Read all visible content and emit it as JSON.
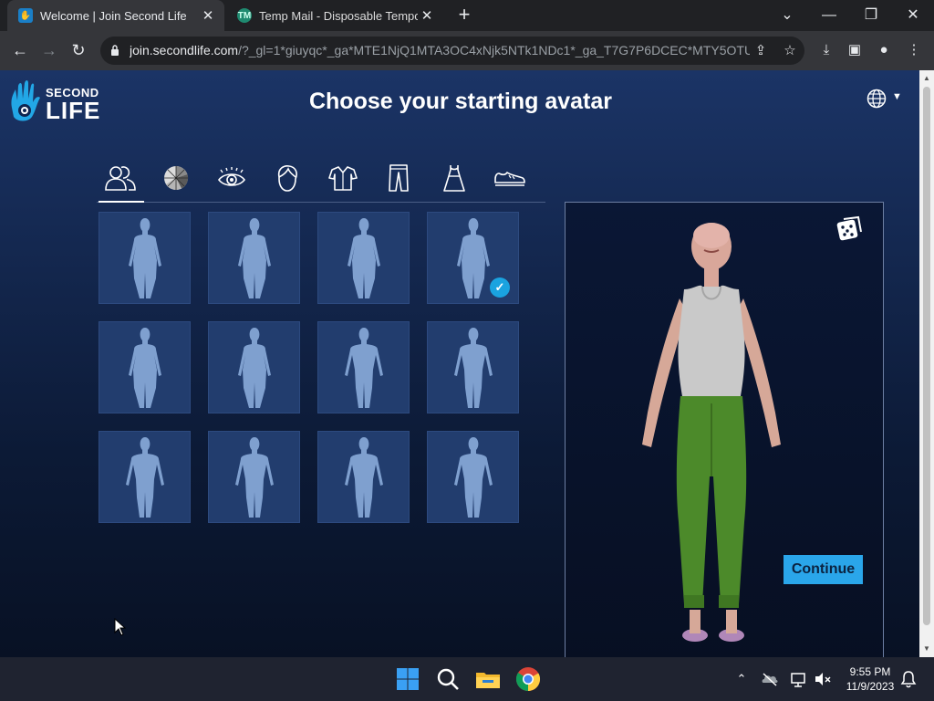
{
  "browser": {
    "tabs": [
      {
        "title": "Welcome | Join Second Life",
        "active": true,
        "favicon": "second-life-hand-icon"
      },
      {
        "title": "Temp Mail - Disposable Tempora",
        "active": false,
        "favicon": "temp-mail-icon"
      }
    ],
    "new_tab_label": "+",
    "url_host": "join.secondlife.com",
    "url_rest": "/?_gl=1*giuyqc*_ga*MTE1NjQ1MTA3OC4xNjk5NTk1NDc1*_ga_T7G7P6DCEC*MTY5OTU...",
    "toolbar_icons": [
      "back-icon",
      "forward-icon",
      "reload-icon",
      "lock-icon",
      "share-icon",
      "star-icon",
      "download-icon",
      "sidepanel-icon",
      "profile-icon",
      "kebab-menu-icon"
    ]
  },
  "page": {
    "logo_line1": "SECOND",
    "logo_line2": "LIFE",
    "title": "Choose your starting avatar",
    "language_icon": "globe-icon",
    "categories": [
      "avatar-body-icon",
      "skin-tone-icon",
      "eye-icon",
      "hair-icon",
      "shirt-icon",
      "pants-icon",
      "dress-icon",
      "shoe-icon"
    ],
    "selected_category": 0,
    "avatar_count": 12,
    "selected_avatar": 3,
    "continue_label": "Continue",
    "randomize_icon": "dice-icon",
    "colors": {
      "accent": "#2aa6ea",
      "check": "#1aa3e0",
      "tile": "#223d6e"
    }
  },
  "taskbar": {
    "apps": [
      "windows-start-icon",
      "search-icon",
      "file-explorer-icon",
      "chrome-icon"
    ],
    "active_app": "chrome-icon",
    "tray": [
      "chevron-up-icon",
      "onedrive-icon",
      "network-icon",
      "volume-muted-icon",
      "notification-bell-icon"
    ],
    "time": "9:55 PM",
    "date": "11/9/2023"
  }
}
